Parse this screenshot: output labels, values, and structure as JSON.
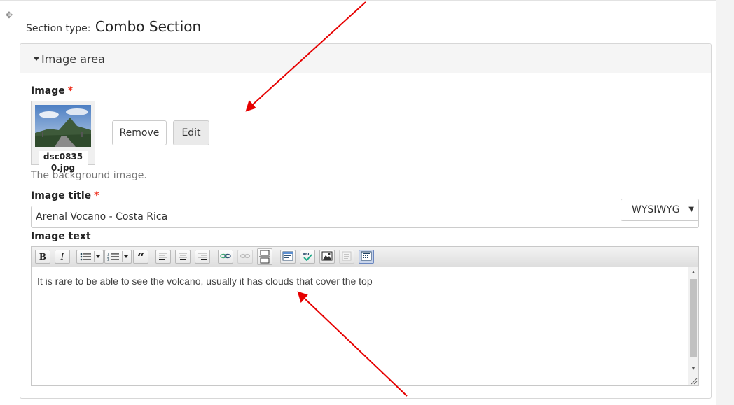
{
  "section": {
    "type_label": "Section type:",
    "type_value": "Combo Section"
  },
  "fieldset": {
    "title": "Image area"
  },
  "image_field": {
    "label": "Image",
    "required_mark": "*",
    "filename_line1": "dsc0835",
    "filename_line2": "0.jpg",
    "remove_label": "Remove",
    "edit_label": "Edit",
    "description": "The background image."
  },
  "image_title_field": {
    "label": "Image title",
    "required_mark": "*",
    "value": "Arenal Vocano - Costa Rica"
  },
  "image_text_field": {
    "label": "Image text",
    "format_select": "WYSIWYG",
    "content": "It is rare to be able to see the volcano, usually it has clouds that cover the top"
  },
  "toolbar": {
    "bold": "B",
    "italic": "I"
  },
  "colors": {
    "required": "#ee3322",
    "annotation_arrow": "#e60000"
  }
}
